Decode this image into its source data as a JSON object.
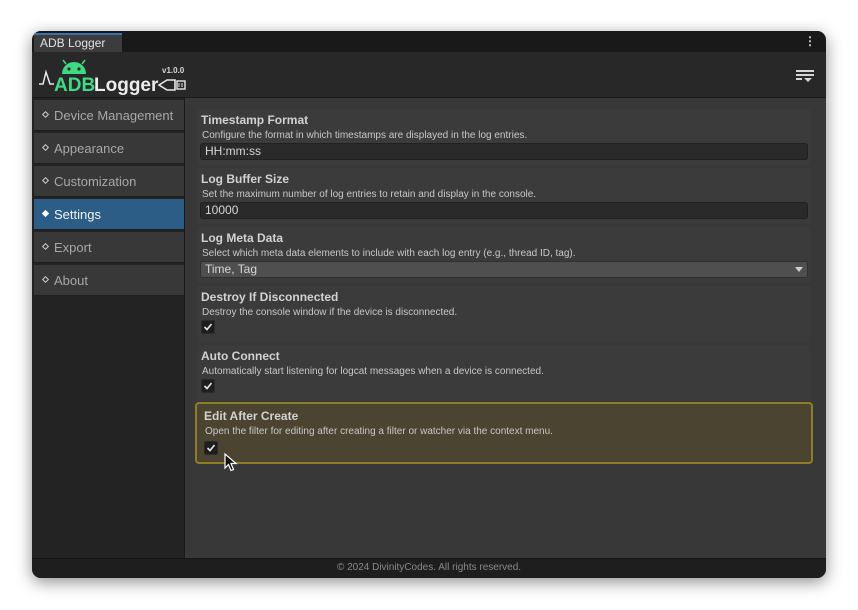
{
  "window": {
    "tab_title": "ADB Logger"
  },
  "header": {
    "logo_text_adb": "ADB",
    "logo_text_logger": "Logger",
    "version": "v1.0.0"
  },
  "sidebar": {
    "items": [
      {
        "label": "Device Management",
        "active": false
      },
      {
        "label": "Appearance",
        "active": false
      },
      {
        "label": "Customization",
        "active": false
      },
      {
        "label": "Settings",
        "active": true
      },
      {
        "label": "Export",
        "active": false
      },
      {
        "label": "About",
        "active": false
      }
    ]
  },
  "settings": {
    "timestamp_format": {
      "title": "Timestamp Format",
      "description": "Configure the format in which timestamps are displayed in the log entries.",
      "value": "HH:mm:ss"
    },
    "log_buffer_size": {
      "title": "Log Buffer Size",
      "description": "Set the maximum number of log entries to retain and display in the console.",
      "value": "10000"
    },
    "log_meta_data": {
      "title": "Log Meta Data",
      "description": "Select which meta data elements to include with each log entry (e.g., thread ID, tag).",
      "value": "Time, Tag"
    },
    "destroy_if_disconnected": {
      "title": "Destroy If Disconnected",
      "description": "Destroy the console window if the device is disconnected.",
      "checked": true
    },
    "auto_connect": {
      "title": "Auto Connect",
      "description": "Automatically start listening for logcat messages when a device is connected.",
      "checked": true
    },
    "edit_after_create": {
      "title": "Edit After Create",
      "description": "Open the filter for editing after creating a filter or watcher via the context menu.",
      "checked": true
    }
  },
  "footer": {
    "copyright": "© 2024 DivinityCodes. All rights reserved."
  },
  "colors": {
    "accent_active": "#2c5d87",
    "highlight_border": "#8e7d27",
    "logo_green": "#3ddc84"
  },
  "icons": [
    "kebab-menu-icon",
    "android-logo-icon",
    "usb-plug-icon",
    "filter-menu-icon",
    "checkmark-icon",
    "mouse-cursor-icon"
  ]
}
